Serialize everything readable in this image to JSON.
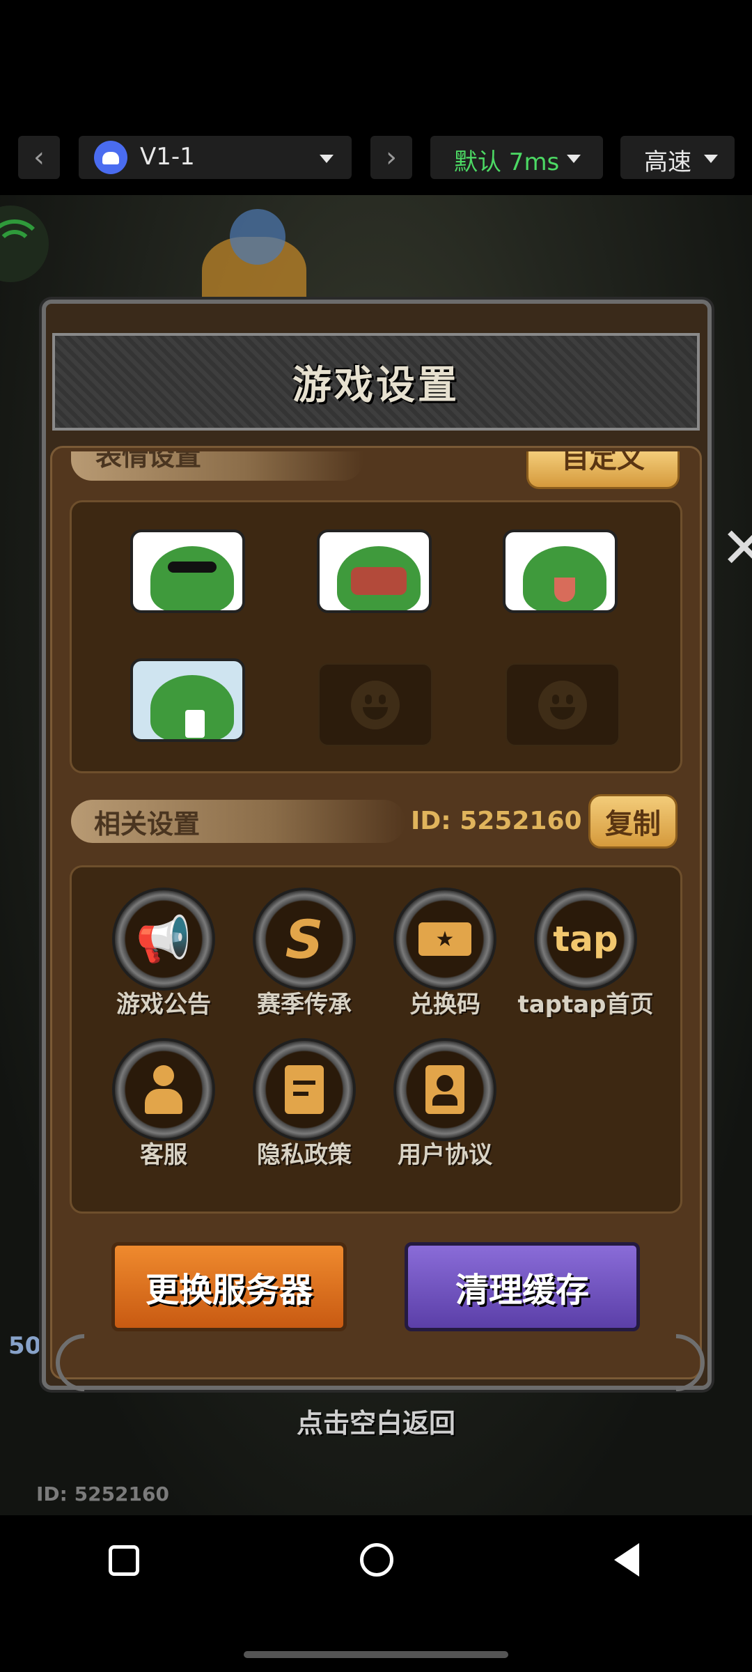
{
  "toolbar": {
    "prev_icon": "chevron-left-icon",
    "next_icon": "chevron-right-icon",
    "device_label": "V1-1",
    "network_label": "默认 7ms",
    "network_color": "#4cd964",
    "speed_label": "高速"
  },
  "dialog": {
    "title": "游戏设置",
    "emotes_header": "表情设置",
    "customize_label": "自定义",
    "emotes": [
      {
        "name": "frog-sunglasses-emote"
      },
      {
        "name": "frog-shout-emote"
      },
      {
        "name": "frog-tongue-emote"
      },
      {
        "name": "frog-cry-emote"
      },
      {
        "name": "empty-emote-slot"
      },
      {
        "name": "empty-emote-slot"
      }
    ],
    "related_header": "相关设置",
    "user_id": "ID: 5252160",
    "copy_label": "复制",
    "items": [
      {
        "label": "游戏公告",
        "icon": "megaphone-icon"
      },
      {
        "label": "赛季传承",
        "icon": "season-s-icon"
      },
      {
        "label": "兑换码",
        "icon": "ticket-icon"
      },
      {
        "label": "taptap首页",
        "icon": "tap"
      },
      {
        "label": "客服",
        "icon": "customer-service-icon"
      },
      {
        "label": "隐私政策",
        "icon": "document-icon"
      },
      {
        "label": "用户协议",
        "icon": "user-card-icon"
      }
    ],
    "change_server_label": "更换服务器",
    "clear_cache_label": "清理缓存"
  },
  "hint": "点击空白返回",
  "footer_id": "ID: 5252160",
  "status_fragment": "50",
  "nav": {
    "recents_icon": "square-icon",
    "home_icon": "circle-icon",
    "back_icon": "triangle-back-icon"
  }
}
